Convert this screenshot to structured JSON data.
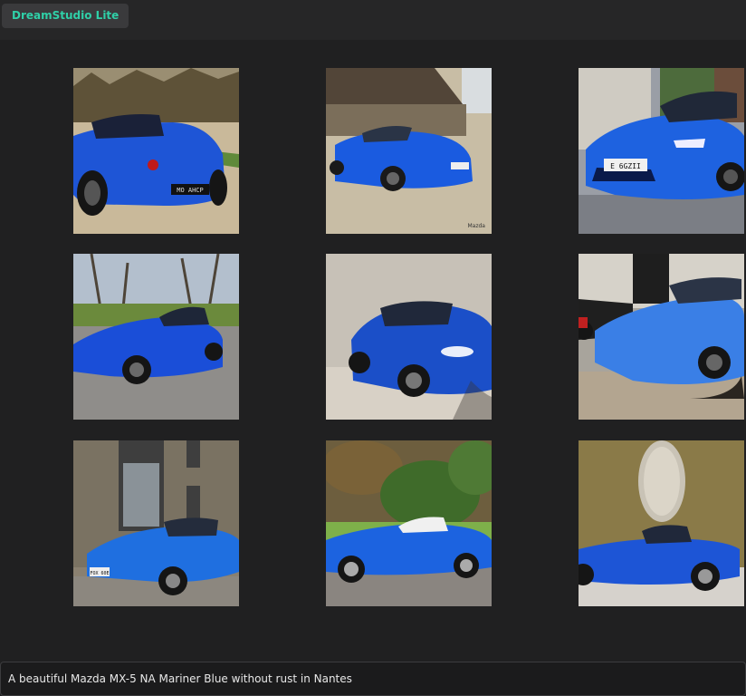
{
  "app": {
    "title": "DreamStudio Lite"
  },
  "gallery": {
    "images": [
      {
        "icon": "blue-roadster-rear-image",
        "plate": "MO AHCP"
      },
      {
        "icon": "blue-roadster-barn-image",
        "plate": "",
        "watermark": "Mazda"
      },
      {
        "icon": "blue-roadster-front-image",
        "plate": "E 6GZII"
      },
      {
        "icon": "blue-roadster-park-image",
        "plate": ""
      },
      {
        "icon": "blue-roadster-studio-image",
        "plate": ""
      },
      {
        "icon": "blue-roadster-garage-image",
        "plate": ""
      },
      {
        "icon": "blue-roadster-building-image",
        "plate": "FOX 60E"
      },
      {
        "icon": "blue-roadster-hardtop-image",
        "plate": ""
      },
      {
        "icon": "blue-roadster-sculpture-image",
        "plate": ""
      }
    ]
  },
  "prompt": {
    "value": "A beautiful Mazda MX-5 NA Mariner Blue without rust in Nantes"
  },
  "colors": {
    "brand": "#2fd0a8",
    "background": "#202021",
    "car_blue": "#1e5fd8"
  }
}
